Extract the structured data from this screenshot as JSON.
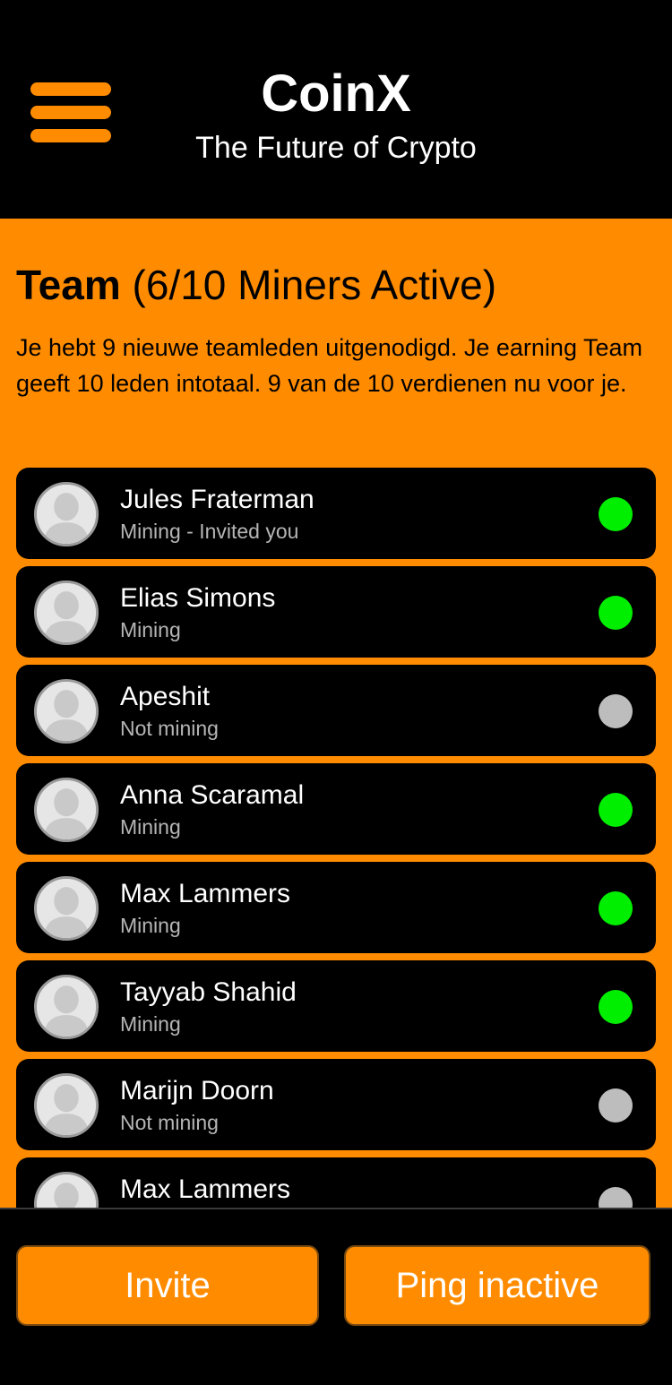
{
  "header": {
    "title": "CoinX",
    "subtitle": "The Future of Crypto"
  },
  "team": {
    "heading_strong": "Team",
    "heading_rest": "(6/10 Miners Active)",
    "description": "Je hebt 9 nieuwe teamleden uitgenodigd. Je earning Team geeft 10 leden intotaal. 9 van de 10 verdienen nu voor je."
  },
  "members": [
    {
      "name": "Jules Fraterman",
      "status": "Mining - Invited you",
      "active": true
    },
    {
      "name": "Elias Simons",
      "status": "Mining",
      "active": true
    },
    {
      "name": "Apeshit",
      "status": "Not mining",
      "active": false
    },
    {
      "name": "Anna Scaramal",
      "status": "Mining",
      "active": true
    },
    {
      "name": "Max Lammers",
      "status": "Mining",
      "active": true
    },
    {
      "name": "Tayyab Shahid",
      "status": "Mining",
      "active": true
    },
    {
      "name": "Marijn Doorn",
      "status": "Not mining",
      "active": false
    },
    {
      "name": "Max Lammers",
      "status": "",
      "active": false
    }
  ],
  "footer": {
    "invite_label": "Invite",
    "ping_label": "Ping inactive"
  },
  "colors": {
    "accent": "#ff8c00",
    "active": "#00ee00",
    "inactive": "#bdbdbd",
    "background": "#000000"
  }
}
